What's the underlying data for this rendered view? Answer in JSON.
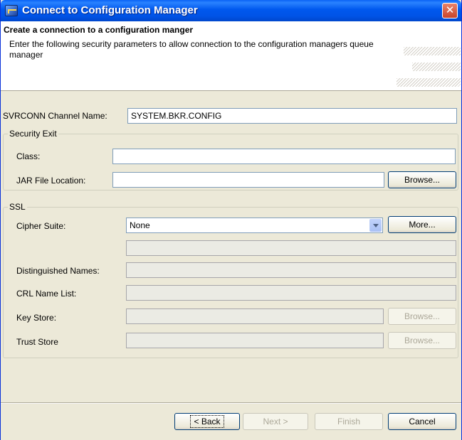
{
  "window": {
    "title": "Connect to Configuration Manager",
    "close_glyph": "✕"
  },
  "banner": {
    "title": "Create a connection to a configuration manger",
    "description": "Enter the following security parameters to allow connection to the configuration managers queue manager"
  },
  "svrconn": {
    "label": "SVRCONN Channel Name:",
    "value": "SYSTEM.BKR.CONFIG"
  },
  "security_exit": {
    "legend": "Security Exit",
    "class_label": "Class:",
    "class_value": "",
    "jar_label": "JAR File Location:",
    "jar_value": "",
    "browse_label": "Browse..."
  },
  "ssl": {
    "legend": "SSL",
    "cipher_label": "Cipher Suite:",
    "cipher_value": "None",
    "more_label": "More...",
    "cipher_detail_value": "",
    "dn_label": "Distinguished Names:",
    "dn_value": "",
    "crl_label": "CRL Name List:",
    "crl_value": "",
    "keystore_label": "Key Store:",
    "keystore_value": "",
    "keystore_browse": "Browse...",
    "truststore_label": "Trust Store",
    "truststore_value": "",
    "truststore_browse": "Browse..."
  },
  "buttons": {
    "back": "< Back",
    "next": "Next >",
    "finish": "Finish",
    "cancel": "Cancel"
  },
  "colors": {
    "titlebar": "#0058ee",
    "dialog_bg": "#ece9d8",
    "field_border": "#7f9db9",
    "disabled_field": "#ebebe4"
  },
  "icons": {
    "app": "app-icon",
    "close": "close-icon",
    "dropdown": "chevron-down-icon"
  }
}
